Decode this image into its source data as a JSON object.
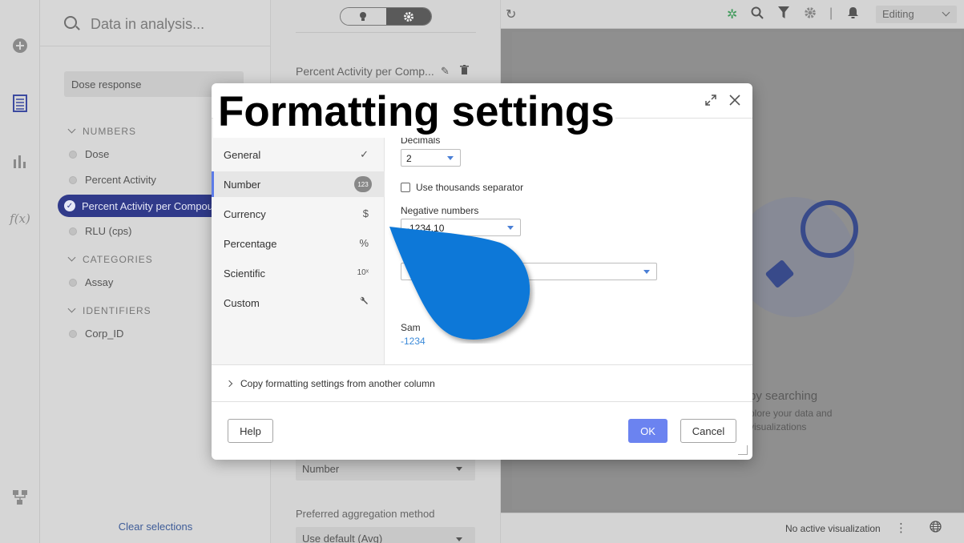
{
  "sidebar_icons": [
    "add-icon",
    "data-table-icon",
    "visualizations-icon",
    "expression-icon",
    "data-canvas-icon"
  ],
  "data_panel": {
    "search_placeholder": "Data in analysis...",
    "table_name": "Dose response",
    "categories": [
      {
        "label": "NUMBERS"
      },
      {
        "label": "CATEGORIES"
      },
      {
        "label": "IDENTIFIERS"
      }
    ],
    "columns": {
      "dose": "Dose",
      "percent_activity": "Percent Activity",
      "percent_activity_per_compound": "Percent Activity per Compound",
      "rlu": "RLU (cps)",
      "assay": "Assay",
      "corp_id": "Corp_ID"
    },
    "clear_selections": "Clear selections"
  },
  "properties_panel": {
    "column_title": "Percent Activity per Comp...",
    "data_type_value": "Number",
    "aggregation_label": "Preferred aggregation method",
    "aggregation_value": "Use default (Avg)"
  },
  "topbar": {
    "mode": "Editing"
  },
  "canvas": {
    "empty_title": "by searching",
    "empty_line1": "plore your data and",
    "empty_line2": "visualizations",
    "status": "No active visualization"
  },
  "dialog": {
    "nav": {
      "general": "General",
      "number": "Number",
      "number_badge": "123",
      "currency": "Currency",
      "currency_icon": "$",
      "percentage": "Percentage",
      "percentage_icon": "%",
      "scientific": "Scientific",
      "scientific_icon": "10ˣ",
      "custom": "Custom"
    },
    "decimals_label": "Decimals",
    "decimals_value": "2",
    "thousands_label": "Use thousands separator",
    "thousands_checked": false,
    "negative_label": "Negative numbers",
    "negative_value": "-1234.10",
    "sample_label": "Sam",
    "sample_value": "-1234",
    "copy_settings": "Copy formatting settings from another column",
    "help": "Help",
    "ok": "OK",
    "cancel": "Cancel"
  },
  "caption": "Formatting settings",
  "colors": {
    "accent": "#6b83f0",
    "pointer": "#0a78d8",
    "selection": "#303a8a"
  }
}
